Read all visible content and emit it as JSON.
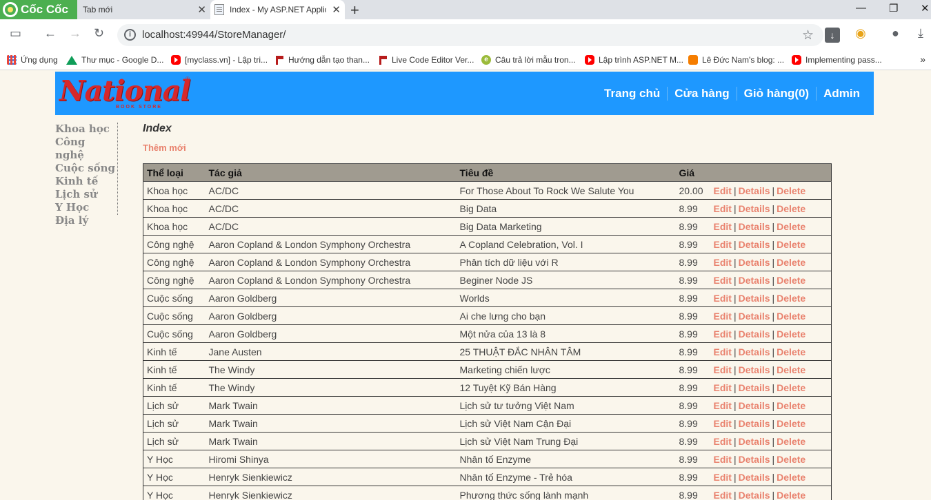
{
  "browser": {
    "brand": "Cốc Cốc",
    "tabs": [
      {
        "title": "Tab mới",
        "active": false
      },
      {
        "title": "Index - My ASP.NET Application",
        "active": true
      }
    ],
    "url": "localhost:49944/StoreManager/",
    "bookmarks": [
      {
        "label": "Ứng dụng",
        "icon": "apps-grid-icon"
      },
      {
        "label": "Thư mục - Google D...",
        "icon": "google-drive-icon"
      },
      {
        "label": "[myclass.vn] - Lập tri...",
        "icon": "youtube-icon"
      },
      {
        "label": "Hướng dẫn tạo than...",
        "icon": "flag-icon"
      },
      {
        "label": "Live Code Editor Ver...",
        "icon": "flag-icon"
      },
      {
        "label": "Câu trả lời mẫu tron...",
        "icon": "e-icon"
      },
      {
        "label": "Lập trình ASP.NET M...",
        "icon": "youtube-icon"
      },
      {
        "label": "Lê Đức Nam's blog: ...",
        "icon": "blogger-icon"
      },
      {
        "label": "Implementing pass...",
        "icon": "youtube-icon"
      }
    ]
  },
  "site": {
    "logo_text": "National",
    "logo_sub": "BOOK STORE",
    "nav": [
      "Trang chủ",
      "Cửa hàng",
      "Giỏ hàng(0)",
      "Admin"
    ],
    "sidebar": [
      "Khoa học",
      "Công nghệ",
      "Cuộc sống",
      "Kinh tế",
      "Lịch sử",
      "Y Học",
      "Địa lý"
    ]
  },
  "page": {
    "title": "Index",
    "create_link": "Thêm mới"
  },
  "table": {
    "headers": [
      "Thể loại",
      "Tác giả",
      "Tiêu đề",
      "Giá",
      ""
    ],
    "actions": [
      "Edit",
      "Details",
      "Delete"
    ],
    "rows": [
      [
        "Khoa học",
        "AC/DC",
        "For Those About To Rock We Salute You",
        "20.00"
      ],
      [
        "Khoa học",
        "AC/DC",
        "Big Data",
        "8.99"
      ],
      [
        "Khoa học",
        "AC/DC",
        "Big Data Marketing",
        "8.99"
      ],
      [
        "Công nghệ",
        "Aaron Copland & London Symphony Orchestra",
        "A Copland Celebration, Vol. I",
        "8.99"
      ],
      [
        "Công nghệ",
        "Aaron Copland & London Symphony Orchestra",
        "Phân tích dữ liệu với R",
        "8.99"
      ],
      [
        "Công nghệ",
        "Aaron Copland & London Symphony Orchestra",
        "Beginer Node JS",
        "8.99"
      ],
      [
        "Cuộc sống",
        "Aaron Goldberg",
        "Worlds",
        "8.99"
      ],
      [
        "Cuộc sống",
        "Aaron Goldberg",
        "Ai che lưng cho bạn",
        "8.99"
      ],
      [
        "Cuộc sống",
        "Aaron Goldberg",
        "Một nửa của 13 là 8",
        "8.99"
      ],
      [
        "Kinh tế",
        "Jane Austen",
        "25 THUẬT ĐẮC NHÂN TÂM",
        "8.99"
      ],
      [
        "Kinh tế",
        "The Windy",
        "Marketing chiến lược",
        "8.99"
      ],
      [
        "Kinh tế",
        "The Windy",
        "12 Tuyệt Kỹ Bán Hàng",
        "8.99"
      ],
      [
        "Lịch sử",
        "Mark Twain",
        "Lịch sử tư tưởng Việt Nam",
        "8.99"
      ],
      [
        "Lịch sử",
        "Mark Twain",
        "Lịch sử Việt Nam Cận Đại",
        "8.99"
      ],
      [
        "Lịch sử",
        "Mark Twain",
        "Lịch sử Việt Nam Trung Đại",
        "8.99"
      ],
      [
        "Y Học",
        "Hiromi Shinya",
        "Nhân tố Enzyme",
        "8.99"
      ],
      [
        "Y Học",
        "Henryk Sienkiewicz",
        "Nhân tố Enzyme - Trẻ hóa",
        "8.99"
      ],
      [
        "Y Học",
        "Henryk Sienkiewicz",
        "Phương thức sống lành mạnh",
        "8.99"
      ]
    ]
  },
  "colors": {
    "header_bg": "#1e98ff",
    "link": "#e9826e",
    "table_header": "#a09b90",
    "page_bg": "#faf6ec"
  }
}
